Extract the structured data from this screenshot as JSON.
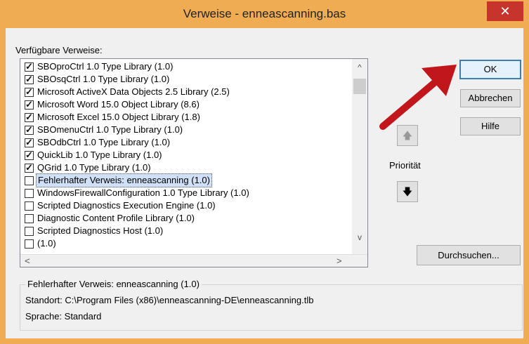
{
  "window": {
    "title": "Verweise - enneascanning.bas",
    "close_glyph": "✕"
  },
  "available_label": "Verfügbare Verweise:",
  "references": [
    {
      "label": "SBOproCtrl 1.0 Type Library (1.0)",
      "checked": true,
      "selected": false
    },
    {
      "label": "SBOsqCtrl 1.0 Type Library (1.0)",
      "checked": true,
      "selected": false
    },
    {
      "label": "Microsoft ActiveX Data Objects 2.5 Library (2.5)",
      "checked": true,
      "selected": false
    },
    {
      "label": "Microsoft Word 15.0 Object Library (8.6)",
      "checked": true,
      "selected": false
    },
    {
      "label": "Microsoft Excel 15.0 Object Library (1.8)",
      "checked": true,
      "selected": false
    },
    {
      "label": "SBOmenuCtrl 1.0 Type Library (1.0)",
      "checked": true,
      "selected": false
    },
    {
      "label": "SBOdbCtrl 1.0 Type Library (1.0)",
      "checked": true,
      "selected": false
    },
    {
      "label": "QuickLib 1.0 Type Library (1.0)",
      "checked": true,
      "selected": false
    },
    {
      "label": "QGrid 1.0 Type Library (1.0)",
      "checked": true,
      "selected": false
    },
    {
      "label": "Fehlerhafter Verweis: enneascanning (1.0)",
      "checked": false,
      "selected": true
    },
    {
      "label": "WindowsFirewallConfiguration 1.0 Type Library (1.0)",
      "checked": false,
      "selected": false
    },
    {
      "label": "Scripted Diagnostics Execution Engine (1.0)",
      "checked": false,
      "selected": false
    },
    {
      "label": "Diagnostic Content Profile Library (1.0)",
      "checked": false,
      "selected": false
    },
    {
      "label": "Scripted Diagnostics Host (1.0)",
      "checked": false,
      "selected": false
    },
    {
      "label": " (1.0)",
      "checked": false,
      "selected": false
    }
  ],
  "buttons": {
    "ok": "OK",
    "cancel": "Abbrechen",
    "help": "Hilfe",
    "browse": "Durchsuchen...",
    "priority_up": "🡅",
    "priority_down": "🡇"
  },
  "priority_label": "Priorität",
  "details": {
    "title": "Fehlerhafter Verweis: enneascanning (1.0)",
    "location": "Standort: C:\\Program Files (x86)\\enneascanning-DE\\enneascanning.tlb",
    "language": "Sprache: Standard"
  },
  "scroll": {
    "up": "^",
    "down": "v",
    "left": "<",
    "right": ">"
  },
  "colors": {
    "title_bar": "#f0ac52",
    "close": "#c7342b",
    "selection": "#cfe0f7",
    "annotation_arrow": "#c0161c"
  }
}
